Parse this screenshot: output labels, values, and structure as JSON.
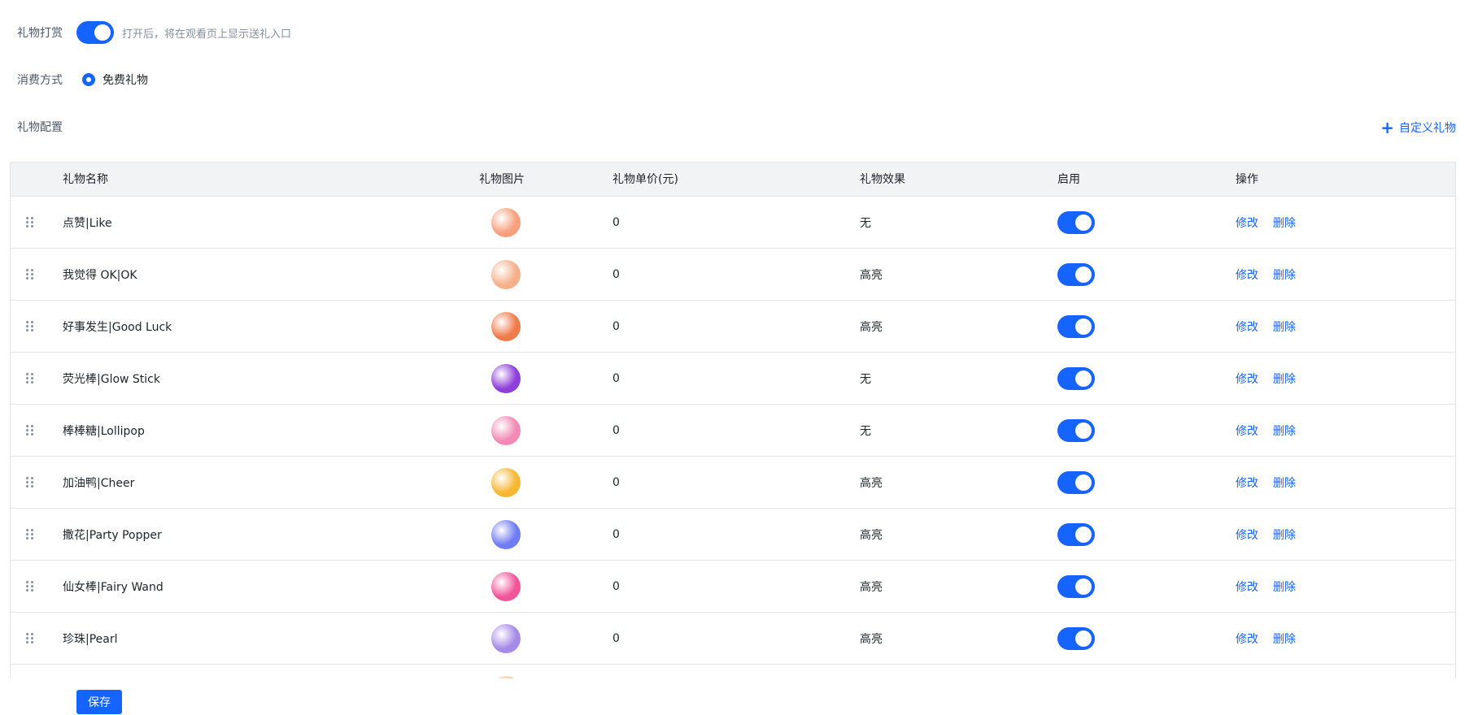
{
  "tipping": {
    "label": "礼物打赏",
    "enabled": true,
    "hint": "打开后，将在观看页上显示送礼入口"
  },
  "consumption": {
    "label": "消费方式",
    "selected": "免费礼物"
  },
  "config": {
    "label": "礼物配置",
    "custom_gift_label": "自定义礼物"
  },
  "table": {
    "headers": {
      "name": "礼物名称",
      "image": "礼物图片",
      "price": "礼物单价(元)",
      "effect": "礼物效果",
      "enable": "启用",
      "ops": "操作"
    },
    "edit_label": "修改",
    "delete_label": "删除",
    "rows": [
      {
        "name": "点赞|Like",
        "price": "0",
        "effect": "无",
        "enabled": true,
        "icon": "thumbs-up-icon",
        "color": "#f7a07c"
      },
      {
        "name": "我觉得 OK|OK",
        "price": "0",
        "effect": "高亮",
        "enabled": true,
        "icon": "ok-hand-icon",
        "color": "#f5b08a"
      },
      {
        "name": "好事发生|Good Luck",
        "price": "0",
        "effect": "高亮",
        "enabled": true,
        "icon": "persimmon-icon",
        "color": "#f07b4a"
      },
      {
        "name": "荧光棒|Glow Stick",
        "price": "0",
        "effect": "无",
        "enabled": true,
        "icon": "glow-stick-icon",
        "color": "#8e3fd9"
      },
      {
        "name": "棒棒糖|Lollipop",
        "price": "0",
        "effect": "无",
        "enabled": true,
        "icon": "lollipop-icon",
        "color": "#f28ab5"
      },
      {
        "name": "加油鸭|Cheer",
        "price": "0",
        "effect": "高亮",
        "enabled": true,
        "icon": "cheer-duck-icon",
        "color": "#f7b733"
      },
      {
        "name": "撒花|Party Popper",
        "price": "0",
        "effect": "高亮",
        "enabled": true,
        "icon": "party-popper-icon",
        "color": "#6f7cf2"
      },
      {
        "name": "仙女棒|Fairy Wand",
        "price": "0",
        "effect": "高亮",
        "enabled": true,
        "icon": "fairy-wand-icon",
        "color": "#f2559a"
      },
      {
        "name": "珍珠|Pearl",
        "price": "0",
        "effect": "高亮",
        "enabled": true,
        "icon": "pearl-shell-icon",
        "color": "#a58ae8"
      },
      {
        "name": "",
        "price": "",
        "effect": "",
        "enabled": true,
        "icon": "gift-icon",
        "color": "#f5c6a0"
      }
    ]
  },
  "save_label": "保存",
  "colors": {
    "accent": "#1664ff",
    "muted": "#86909c",
    "border": "#e5e6eb",
    "header_bg": "#f2f3f5"
  }
}
